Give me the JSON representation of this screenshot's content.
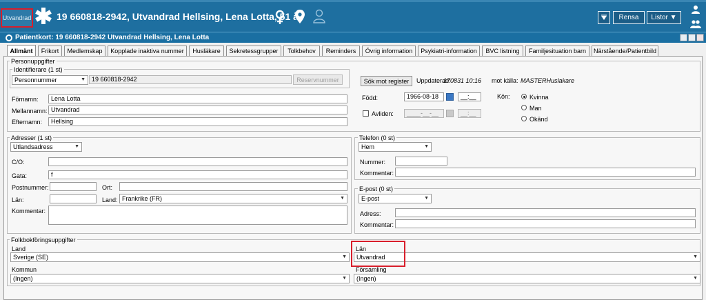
{
  "header": {
    "badge": "Utvandrad",
    "patient_title": "19 660818-2942,  Utvandrad Hellsing, Lena Lotta,  51 år",
    "rensa": "Rensa",
    "listor": "Listor"
  },
  "window": {
    "title": "Patientkort: 19 660818-2942 Utvandrad Hellsing, Lena Lotta"
  },
  "tabs": [
    "Allmänt",
    "Frikort",
    "Medlemskap",
    "Kopplade inaktiva nummer",
    "Husläkare",
    "Sekretessgrupper",
    "Tolkbehov",
    "Reminders",
    "Övrig information",
    "Psykiatri-information",
    "BVC listning",
    "Familjesituation barn",
    "Närstående/Patientbild"
  ],
  "person": {
    "group": "Personuppgifter",
    "ident_group": "Identifierare (1 st)",
    "ident_type": "Personnummer",
    "ident_value": "19 660818-2942",
    "reserve_btn": "Reservnummer",
    "search_btn": "Sök mot register",
    "updated_label": "Uppdaterad:",
    "updated_value": "170831 10:16",
    "source_label": "mot källa:",
    "source_value": "MASTERHuslakare",
    "firstname_label": "Förnamn:",
    "firstname": "Lena Lotta",
    "middlename_label": "Mellannamn:",
    "middlename": "Utvandrad",
    "lastname_label": "Efternamn:",
    "lastname": "Hellsing",
    "born_label": "Född:",
    "born_date": "1966-08-18",
    "born_time": "__:__",
    "dead_label": "Avliden:",
    "dead_date": "____-__-__",
    "dead_time": "__:__",
    "gender_label": "Kön:",
    "gender_options": [
      "Kvinna",
      "Man",
      "Okänd"
    ],
    "gender_selected": "Kvinna"
  },
  "address": {
    "group": "Adresser (1 st)",
    "type": "Utlandsadress",
    "co_label": "C/O:",
    "co": "",
    "street_label": "Gata:",
    "street": "f",
    "zip_label": "Postnummer:",
    "zip": "",
    "city_label": "Ort:",
    "city": "",
    "county_label": "Län:",
    "county": "",
    "country_label": "Land:",
    "country": "Frankrike (FR)",
    "comment_label": "Kommentar:",
    "comment": ""
  },
  "phone": {
    "group": "Telefon (0 st)",
    "type": "Hem",
    "number_label": "Nummer:",
    "comment_label": "Kommentar:"
  },
  "email": {
    "group": "E-post (0 st)",
    "type": "E-post",
    "address_label": "Adress:",
    "comment_label": "Kommentar:"
  },
  "folkbokforing": {
    "group": "Folkbokföringsuppgifter",
    "land_label": "Land",
    "land": "Sverige (SE)",
    "lan_label": "Län",
    "lan": "Utvandrad",
    "kommun_label": "Kommun",
    "kommun": "(Ingen)",
    "forsamling_label": "Församling",
    "forsamling": "(Ingen)"
  },
  "colors": {
    "header_bg": "#1e6fa0",
    "highlight": "#d81e2b",
    "calendar": "#3b78c4"
  }
}
